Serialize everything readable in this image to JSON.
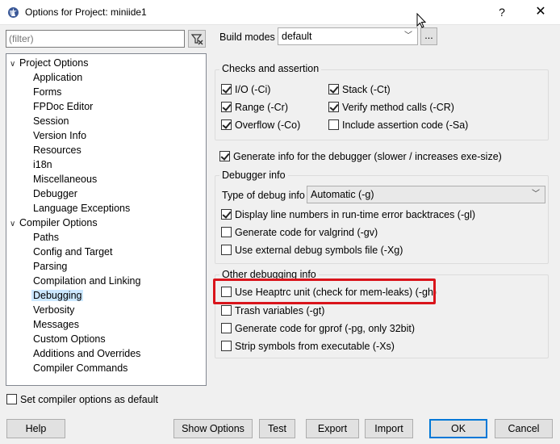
{
  "window": {
    "title": "Options for Project: miniide1",
    "help_glyph": "?",
    "close_glyph": "✕"
  },
  "filter": {
    "placeholder": "(filter)"
  },
  "tree": {
    "project_options": "Project Options",
    "project_children": [
      "Application",
      "Forms",
      "FPDoc Editor",
      "Session",
      "Version Info",
      "Resources",
      "i18n",
      "Miscellaneous",
      "Debugger",
      "Language Exceptions"
    ],
    "compiler_options": "Compiler Options",
    "compiler_children": [
      "Paths",
      "Config and Target",
      "Parsing",
      "Compilation and Linking",
      "Debugging",
      "Verbosity",
      "Messages",
      "Custom Options",
      "Additions and Overrides",
      "Compiler Commands"
    ],
    "selected": "Debugging"
  },
  "set_default": {
    "label": "Set compiler options as default",
    "checked": false
  },
  "build_modes": {
    "label": "Build modes",
    "value": "default",
    "more": "..."
  },
  "checks": {
    "title": "Checks and assertion",
    "io": {
      "label": "I/O (-Ci)",
      "checked": true
    },
    "range": {
      "label": "Range (-Cr)",
      "checked": true
    },
    "overflow": {
      "label": "Overflow (-Co)",
      "checked": true
    },
    "stack": {
      "label": "Stack (-Ct)",
      "checked": true
    },
    "verify": {
      "label": "Verify method calls (-CR)",
      "checked": true
    },
    "assertion": {
      "label": "Include assertion code (-Sa)",
      "checked": false
    }
  },
  "generate_info": {
    "label": "Generate info for the debugger (slower / increases exe-size)",
    "checked": true
  },
  "debugger_info": {
    "title": "Debugger info",
    "type_label": "Type of debug info",
    "type_value": "Automatic (-g)",
    "line_numbers": {
      "label": "Display line numbers in run-time error backtraces (-gl)",
      "checked": true
    },
    "valgrind": {
      "label": "Generate code for valgrind (-gv)",
      "checked": false
    },
    "external": {
      "label": "Use external debug symbols file (-Xg)",
      "checked": false
    }
  },
  "other_info": {
    "title": "Other debugging info",
    "heaptrc": {
      "label": "Use Heaptrc unit (check for mem-leaks) (-gh)",
      "checked": false
    },
    "trash": {
      "label": "Trash variables (-gt)",
      "checked": false
    },
    "gprof": {
      "label": "Generate code for gprof (-pg, only 32bit)",
      "checked": false
    },
    "strip": {
      "label": "Strip symbols from executable (-Xs)",
      "checked": false
    }
  },
  "buttons": {
    "help": "Help",
    "show_options": "Show Options",
    "test": "Test",
    "export": "Export",
    "import": "Import",
    "ok": "OK",
    "cancel": "Cancel"
  },
  "colors": {
    "highlight": "#d9141b",
    "selection": "#cce8ff",
    "default_button": "#0078d7"
  }
}
